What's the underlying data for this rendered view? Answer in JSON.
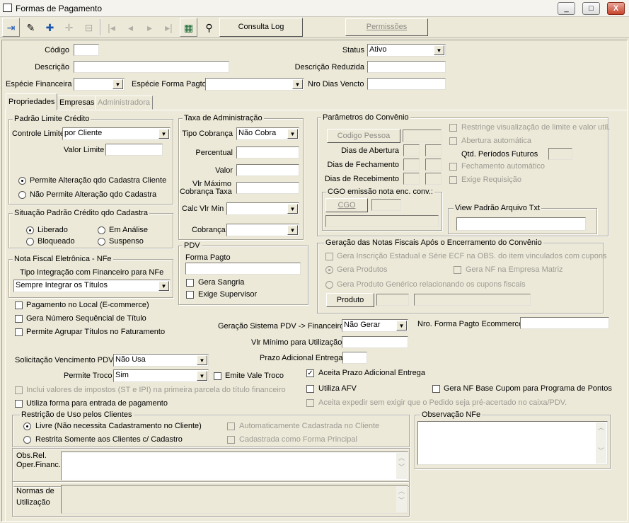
{
  "window": {
    "title": "Formas de Pagamento",
    "minimize": "_",
    "maximize": "□",
    "close": "X"
  },
  "toolbar": {
    "consulta_log": "Consulta Log",
    "permissoes": "Permissões"
  },
  "header": {
    "codigo_label": "Código",
    "codigo_value": "",
    "status_label": "Status",
    "status_value": "Ativo",
    "descricao_label": "Descrição",
    "descricao_value": "",
    "descricao_reduzida_label": "Descrição Reduzida",
    "descricao_reduzida_value": "",
    "especie_financeira_label": "Espécie Financeira",
    "especie_financeira_value": "",
    "especie_forma_pagto_label": "Espécie Forma Pagto",
    "especie_forma_pagto_value": "",
    "nro_dias_vencto_label": "Nro Dias Vencto",
    "nro_dias_vencto_value": ""
  },
  "tabs": [
    "Propriedades",
    "Empresas",
    "Administradora"
  ],
  "padrao_limite": {
    "title": "Padrão Limite Crédito",
    "controle_label": "Controle Limite",
    "controle_value": "por Cliente",
    "valor_limite_label": "Valor Limite",
    "valor_limite_value": "",
    "radio1": "Permite Alteração qdo Cadastra Cliente",
    "radio2": "Não Permite Alteração qdo Cadastra"
  },
  "situacao": {
    "title": "Situação Padrão Crédito qdo Cadastra",
    "liberado": "Liberado",
    "em_analise": "Em Análise",
    "bloqueado": "Bloqueado",
    "suspenso": "Suspenso"
  },
  "nfe": {
    "title": "Nota Fiscal Eletrônica - NFe",
    "tipo_label": "Tipo Integração com Financeiro para NFe",
    "tipo_value": "Sempre Integrar os Títulos"
  },
  "checks_left": {
    "pagamento_local": "Pagamento no Local (E-commerce)",
    "gera_numero": "Gera Número Sequêncial de Título",
    "permite_agrupar": "Permite Agrupar Títulos no Faturamento"
  },
  "taxa": {
    "title": "Taxa de Administração",
    "tipo_label": "Tipo Cobrança",
    "tipo_value": "Não Cobra",
    "percentual_label": "Percentual",
    "valor_label": "Valor",
    "vlr_max_label1": "Vlr Máximo",
    "vlr_max_label2": "Cobrança Taxa",
    "calc_label": "Calc Vlr Min",
    "calc_value": "",
    "cobranca_label": "Cobrança",
    "cobranca_value": ""
  },
  "pdv": {
    "title": "PDV",
    "forma_pagto_label": "Forma Pagto",
    "forma_pagto_value": "",
    "gera_sangria": "Gera Sangria",
    "exige_supervisor": "Exige Supervisor"
  },
  "convenio": {
    "title": "Parâmetros do Convênio",
    "codigo_pessoa": "Codigo Pessoa",
    "dias_abertura": "Dias de Abertura",
    "dias_fechamento": "Dias de Fechamento",
    "dias_recebimento": "Dias de Recebimento",
    "restringe": "Restringe visualização de limite e valor util.",
    "abertura_auto": "Abertura automática",
    "qtd_periodos": "Qtd. Períodos Futuros",
    "fechamento_auto": "Fechamento automático",
    "exige_requisicao": "Exige Requisição",
    "cgo_title": "CGO emissão nota enc. conv.:",
    "cgo_button": "CGO",
    "view_title": "View Padrão Arquivo Txt"
  },
  "geracao": {
    "title": "Geração das Notas Fiscais Após o Encerramento do Convênio",
    "gera_inscricao": "Gera Inscrição Estadual e Série ECF na OBS. do item vinculados com cupons",
    "gera_produtos": "Gera Produtos",
    "gera_nf_matriz": "Gera NF na Empresa Matriz",
    "gera_produto_generico": "Gera Produto Genérico relacionando os cupons fiscais",
    "produto_button": "Produto"
  },
  "middle": {
    "geracao_sistema_label": "Geração Sistema PDV -> Financeiro",
    "geracao_sistema_value": "Não Gerar",
    "nro_forma_label": "Nro. Forma Pagto Ecommerce",
    "vlr_minimo_label": "Vlr Mínimo para Utilização",
    "prazo_label": "Prazo Adicional Entrega",
    "solicitacao_label": "Solicitação Vencimento PDV",
    "solicitacao_value": "Não Usa",
    "permite_troco_label": "Permite Troco",
    "permite_troco_value": "Sim",
    "emite_vale": "Emite Vale Troco",
    "aceita_prazo": "Aceita Prazo Adicional Entrega",
    "inclui_valores": "Inclui valores de impostos (ST e IPI) na primeira parcela do título financeiro",
    "utiliza_afv": "Utiliza AFV",
    "gera_nf_base": "Gera NF Base Cupom para Programa de Pontos",
    "utiliza_forma": "Utiliza forma para entrada de pagamento",
    "aceita_expedir": "Aceita expedir sem exigir que o Pedido seja pré-acertado no caixa/PDV."
  },
  "restricao": {
    "title": "Restrição de Uso pelos Clientes",
    "livre": "Livre (Não necessita Cadastramento no Cliente)",
    "restrita": "Restrita Somente aos Clientes c/ Cadastro",
    "auto_cadastrada": "Automaticamente Cadastrada no Cliente",
    "cadastrada_principal": "Cadastrada como Forma Principal"
  },
  "obs_nfe": {
    "title": "Observação NFe"
  },
  "obs_rel": {
    "label1": "Obs.Rel.",
    "label2": "Oper.Financ."
  },
  "normas": {
    "label1": "Normas de",
    "label2": "Utilização"
  }
}
